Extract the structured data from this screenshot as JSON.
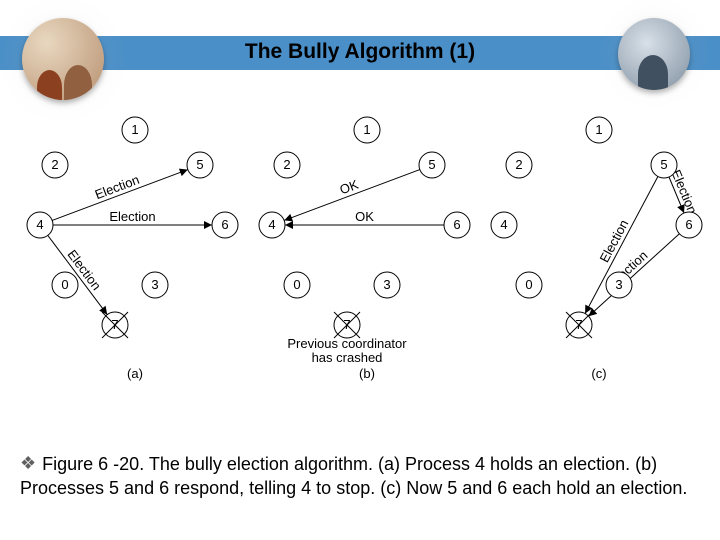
{
  "title": "The Bully Algorithm (1)",
  "figure": {
    "nodes": [
      "1",
      "2",
      "5",
      "4",
      "6",
      "0",
      "3",
      "7"
    ],
    "crashed_label": "Previous coordinator\nhas crashed",
    "panels": [
      {
        "label": "(a)",
        "edges": [
          {
            "text": "Election",
            "from": "4",
            "to": "5"
          },
          {
            "text": "Election",
            "from": "4",
            "to": "6"
          },
          {
            "text": "Election",
            "from": "4",
            "to": "7"
          }
        ]
      },
      {
        "label": "(b)",
        "edges": [
          {
            "text": "OK",
            "from": "5",
            "to": "4"
          },
          {
            "text": "OK",
            "from": "6",
            "to": "4"
          }
        ]
      },
      {
        "label": "(c)",
        "edges": [
          {
            "text": "Election",
            "from": "5",
            "to": "6"
          },
          {
            "text": "Election",
            "from": "6",
            "to": "7"
          },
          {
            "text": "Election",
            "from": "5",
            "to": "7"
          }
        ]
      }
    ]
  },
  "caption": "Figure 6 -20. The bully election algorithm. (a) Process 4 holds an election. (b) Processes 5 and 6 respond, telling 4 to stop. (c) Now 5 and 6 each hold an election."
}
